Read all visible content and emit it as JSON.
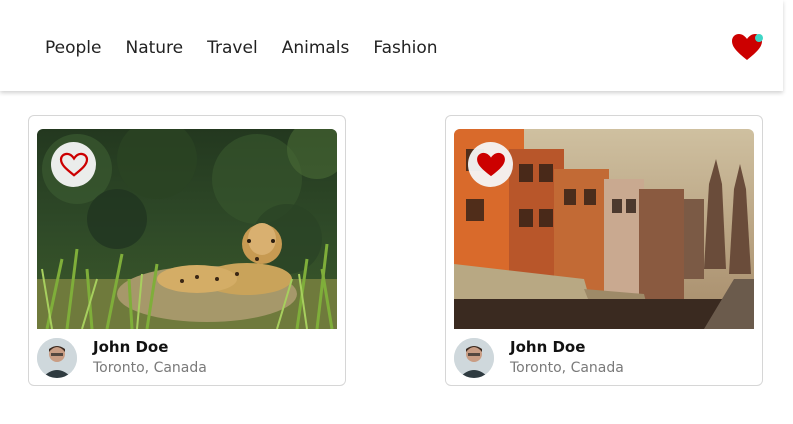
{
  "nav": {
    "links": [
      "People",
      "Nature",
      "Travel",
      "Animals",
      "Fashion"
    ],
    "favorites_icon": "heart-icon",
    "notification_color": "#3fd6c6"
  },
  "colors": {
    "heart": "#cc0000"
  },
  "cards": [
    {
      "image": "jaguar-resting-in-grass",
      "favorite": false,
      "author": "John Doe",
      "location": "Toronto, Canada"
    },
    {
      "image": "old-city-street-buildings",
      "favorite": true,
      "author": "John Doe",
      "location": "Toronto, Canada"
    }
  ]
}
